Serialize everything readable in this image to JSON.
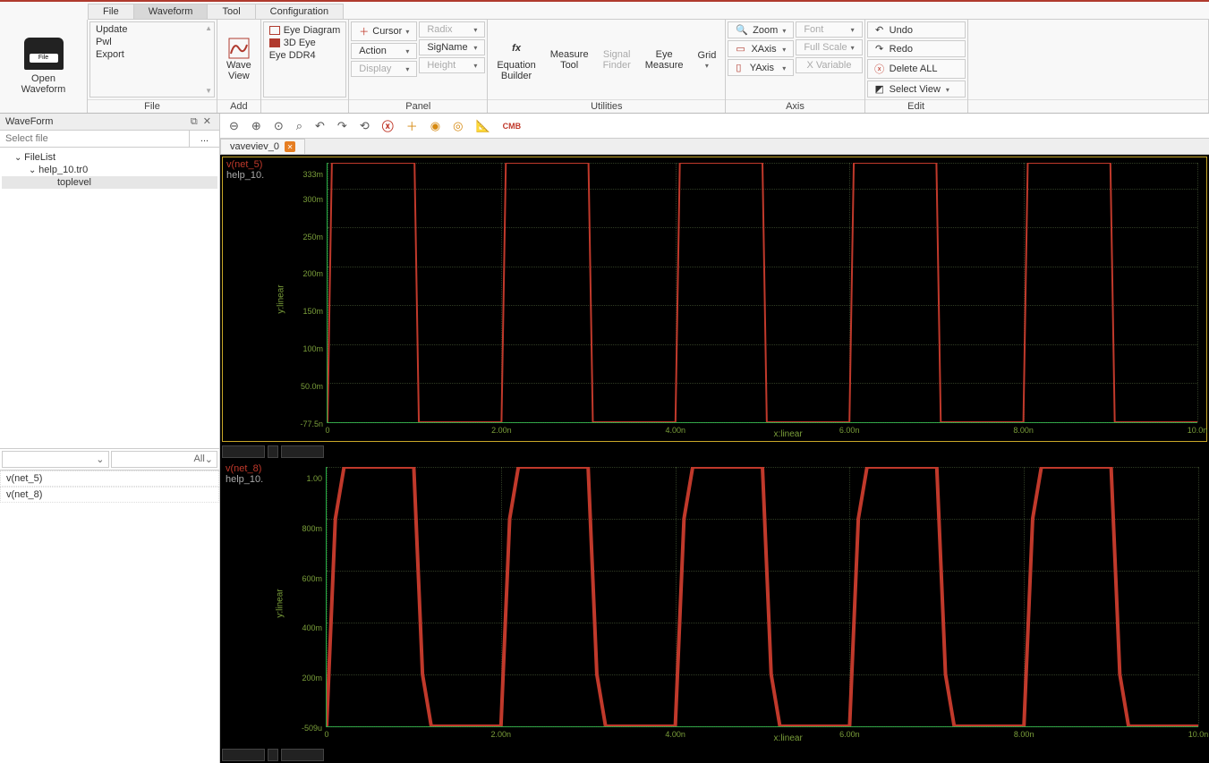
{
  "menu_tabs": {
    "file": "File",
    "waveform": "Waveform",
    "tool": "Tool",
    "configuration": "Configuration"
  },
  "open_waveform": {
    "line1": "Open",
    "line2": "Waveform"
  },
  "ribbon": {
    "file": {
      "update": "Update",
      "pwl": "Pwl",
      "export": "Export",
      "label": "File"
    },
    "waveview": {
      "line1": "Wave",
      "line2": "View",
      "label": "Add"
    },
    "add": {
      "eye_diagram": "Eye Diagram",
      "eye_3d": "3D Eye",
      "eye_ddr4": "Eye DDR4"
    },
    "panel": {
      "cursor": "Cursor",
      "radix": "Radix",
      "action": "Action",
      "signame": "SigName",
      "display": "Display",
      "height": "Height",
      "label": "Panel"
    },
    "utilities": {
      "eq_builder_l1": "fx",
      "eq_builder_l2": "Equation",
      "eq_builder_l3": "Builder",
      "measure_l1": "Measure",
      "measure_l2": "Tool",
      "signal_l1": "Signal",
      "signal_l2": "Finder",
      "eye_l1": "Eye",
      "eye_l2": "Measure",
      "grid": "Grid",
      "label": "Utilities"
    },
    "axis": {
      "zoom": "Zoom",
      "xaxis": "XAxis",
      "yaxis": "YAxis",
      "font": "Font",
      "fullscale": "Full Scale",
      "xvar": "X Variable",
      "label": "Axis"
    },
    "edit": {
      "undo": "Undo",
      "redo": "Redo",
      "delete_all": "Delete ALL",
      "select_view": "Select View",
      "label": "Edit"
    }
  },
  "side": {
    "title": "WaveForm",
    "select_placeholder": "Select file",
    "tree": {
      "filelist": "FileList",
      "file0": "help_10.tr0",
      "toplevel": "toplevel"
    },
    "filter_all": "All",
    "signals": [
      "v(net_5)",
      "v(net_8)"
    ]
  },
  "wave": {
    "cmb": "CMB",
    "tab0": "vaveviev_0"
  },
  "plots": [
    {
      "sig": "v(net_5)",
      "file": "help_10.",
      "ylabel": "y:linear"
    },
    {
      "sig": "v(net_8)",
      "file": "help_10.",
      "ylabel": "y:linear"
    }
  ],
  "xlabel": "x:linear",
  "chart_data": [
    {
      "type": "line",
      "name": "v(net_5)",
      "xlabel": "x:linear",
      "ylabel": "y:linear",
      "xlim": [
        0,
        1e-08
      ],
      "ylim": [
        -7.75e-08,
        0.333
      ],
      "xticks": [
        0,
        2e-09,
        4e-09,
        6e-09,
        8e-09,
        1e-08
      ],
      "xtick_labels": [
        "0",
        "2.00n",
        "4.00n",
        "6.00n",
        "8.00n",
        "10.0n"
      ],
      "yticks": [
        -7.75e-08,
        0.05,
        0.1,
        0.15,
        0.2,
        0.25,
        0.3,
        0.333
      ],
      "ytick_labels": [
        "-77.5n",
        "50.0m",
        "100m",
        "150m",
        "200m",
        "250m",
        "300m",
        "333m"
      ],
      "description": "Square wave, ~333mV high / ~0 low, period ~2ns, 50% duty",
      "x": [
        0,
        5e-11,
        1e-09,
        1.05e-09,
        2e-09,
        2.05e-09,
        3e-09,
        3.05e-09,
        4e-09,
        4.05e-09,
        5e-09,
        5.05e-09,
        6e-09,
        6.05e-09,
        7e-09,
        7.05e-09,
        8e-09,
        8.05e-09,
        9e-09,
        9.05e-09,
        1e-08
      ],
      "y": [
        0,
        0.333,
        0.333,
        0,
        0,
        0.333,
        0.333,
        0,
        0,
        0.333,
        0.333,
        0,
        0,
        0.333,
        0.333,
        0,
        0,
        0.333,
        0.333,
        0,
        0
      ]
    },
    {
      "type": "line",
      "name": "v(net_8)",
      "xlabel": "x:linear",
      "ylabel": "y:linear",
      "xlim": [
        0,
        1e-08
      ],
      "ylim": [
        -0.000509,
        1.0
      ],
      "xticks": [
        0,
        2e-09,
        4e-09,
        6e-09,
        8e-09,
        1e-08
      ],
      "xtick_labels": [
        "0",
        "2.00n",
        "4.00n",
        "6.00n",
        "8.00n",
        "10.0n"
      ],
      "yticks": [
        -0.000509,
        0.2,
        0.4,
        0.6,
        0.8,
        1.0
      ],
      "ytick_labels": [
        "-509u",
        "200m",
        "400m",
        "600m",
        "800m",
        "1.00"
      ],
      "description": "Square wave with rounded edges, 1.0V high / ~0 low, period ~2ns, 50% duty",
      "x": [
        0,
        1e-10,
        2e-10,
        1e-09,
        1.1e-09,
        1.2e-09,
        2e-09,
        2.1e-09,
        2.2e-09,
        3e-09,
        3.1e-09,
        3.2e-09,
        4e-09,
        4.1e-09,
        4.2e-09,
        5e-09,
        5.1e-09,
        5.2e-09,
        6e-09,
        6.1e-09,
        6.2e-09,
        7e-09,
        7.1e-09,
        7.2e-09,
        8e-09,
        8.1e-09,
        8.2e-09,
        9e-09,
        9.1e-09,
        9.2e-09,
        1e-08
      ],
      "y": [
        0,
        0.8,
        1.0,
        1.0,
        0.2,
        0,
        0,
        0.8,
        1.0,
        1.0,
        0.2,
        0,
        0,
        0.8,
        1.0,
        1.0,
        0.2,
        0,
        0,
        0.8,
        1.0,
        1.0,
        0.2,
        0,
        0,
        0.8,
        1.0,
        1.0,
        0.2,
        0,
        0
      ]
    }
  ]
}
